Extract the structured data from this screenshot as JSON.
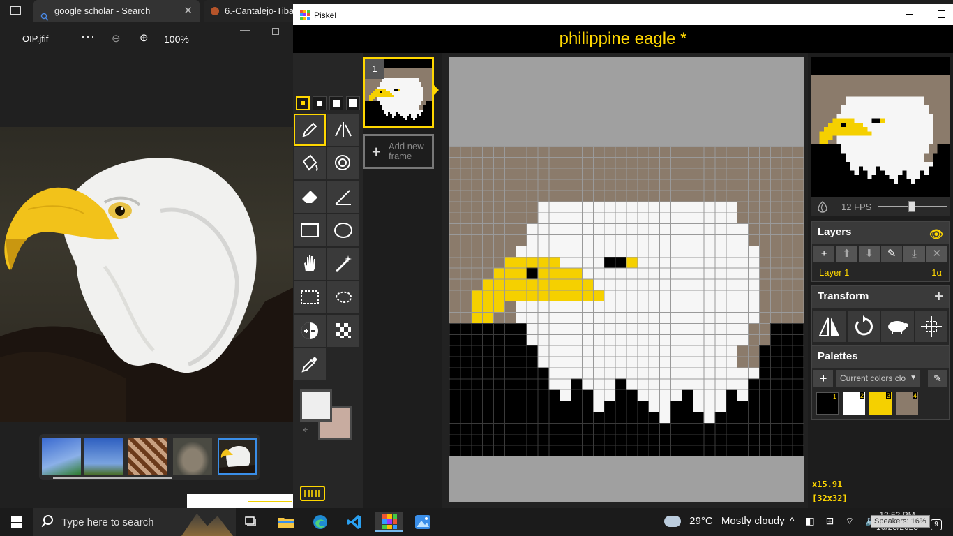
{
  "browser": {
    "tabs": [
      {
        "label": "google scholar - Search",
        "close": "✕"
      },
      {
        "label": "6.-Cantalejo-Tibay"
      }
    ]
  },
  "photo_viewer": {
    "filename": "OIP.jfif",
    "more": "···",
    "zoom_out": "⊖",
    "zoom_in": "⊕",
    "zoom": "100%",
    "minimize": "—"
  },
  "piskel": {
    "window_title": "Piskel",
    "project_title": "philippine eagle *",
    "frame_number": "1",
    "add_frame_label": "Add new frame",
    "swap_icon": "⤶",
    "fps": "12 FPS",
    "fps_value": 12,
    "layers": {
      "title": "Layers",
      "eye": "👁",
      "layer_name": "Layer 1",
      "layer_alpha": "1α",
      "buttons": [
        "+",
        "⬆",
        "⬇",
        "✎",
        "⤓",
        "✕"
      ]
    },
    "transform": {
      "title": "Transform",
      "add": "+"
    },
    "palettes": {
      "title": "Palettes",
      "add": "+",
      "selected": "Current colors clo",
      "caret": "▼",
      "edit": "✎",
      "swatches": [
        {
          "n": "1",
          "color": "#000000"
        },
        {
          "n": "2",
          "color": "#ffffff"
        },
        {
          "n": "3",
          "color": "#f5d000"
        },
        {
          "n": "4",
          "color": "#8b7b6b"
        }
      ]
    },
    "zoom": "x15.91",
    "size": "[32x32]",
    "colors": {
      "primary": "#eeeeee",
      "secondary": "#c8aca0",
      "brown": "#8b7b6b",
      "yellow": "#f5d000",
      "accent": "#ffd700"
    }
  },
  "taskbar": {
    "search_placeholder": "Type here to search",
    "weather_temp": "29°C",
    "weather_text": "Mostly cloudy",
    "tray": [
      "^",
      "◧",
      "⊞",
      "⌔",
      "🔊"
    ],
    "time": "12:52 PM",
    "date": "10/23/2023",
    "tooltip": "Speakers: 16%",
    "notifications": "9"
  }
}
